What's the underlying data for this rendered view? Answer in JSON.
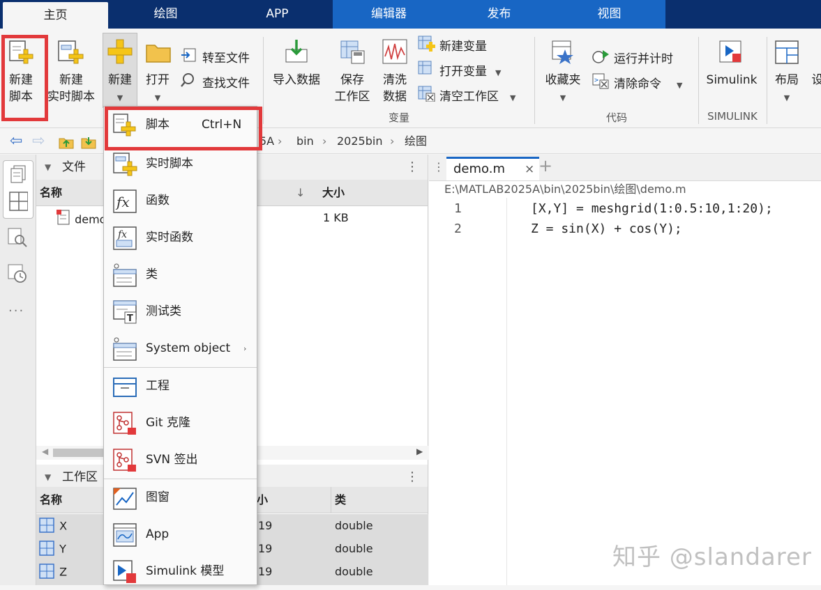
{
  "tabs": [
    "主页",
    "绘图",
    "APP",
    "编辑器",
    "发布",
    "视图"
  ],
  "ribbon": {
    "new_script": "新建\n脚本",
    "new_live_script": "新建\n实时脚本",
    "new": "新建",
    "open": "打开",
    "goto_file": "转至文件",
    "find_files": "查找文件",
    "import_data": "导入数据",
    "save_workspace": "保存\n工作区",
    "clean_data": "清洗\n数据",
    "new_variable": "新建变量",
    "open_variable": "打开变量",
    "clear_workspace": "清空工作区",
    "group_variable": "变量",
    "favorites": "收藏夹",
    "run_and_time": "运行并计时",
    "clear_commands": "清除命令",
    "group_code": "代码",
    "simulink": "Simulink",
    "group_simulink": "SIMULINK",
    "layout": "布局",
    "settings_cut": "设"
  },
  "address": {
    "crumbs": [
      "5A",
      "bin",
      "2025bin",
      "绘图"
    ]
  },
  "files_panel": {
    "title": "文件",
    "col_name": "名称",
    "col_size": "大小",
    "file_name": "demo",
    "file_size": "1 KB"
  },
  "workspace_panel": {
    "title": "工作区",
    "col_name": "名称",
    "col_value": "小",
    "col_class": "类",
    "rows": [
      {
        "name": "X",
        "size": "19",
        "class": "double"
      },
      {
        "name": "Y",
        "size": "19",
        "class": "double"
      },
      {
        "name": "Z",
        "size": "19",
        "class": "double"
      }
    ]
  },
  "editor": {
    "tab_name": "demo.m",
    "path": "E:\\MATLAB2025A\\bin\\2025bin\\绘图\\demo.m",
    "lines": [
      {
        "num": "1",
        "code": "[X,Y] = meshgrid(1:0.5:10,1:20);"
      },
      {
        "num": "2",
        "code": "Z = sin(X) + cos(Y);"
      }
    ]
  },
  "new_menu": {
    "items": [
      {
        "label": "脚本",
        "shortcut": "Ctrl+N"
      },
      {
        "label": "实时脚本"
      },
      {
        "label": "函数"
      },
      {
        "label": "实时函数"
      },
      {
        "label": "类"
      },
      {
        "label": "测试类"
      },
      {
        "label": "System object"
      },
      {
        "label": "工程"
      },
      {
        "label": "Git 克隆"
      },
      {
        "label": "SVN 签出"
      },
      {
        "label": "图窗"
      },
      {
        "label": "App"
      },
      {
        "label": "Simulink 模型"
      }
    ]
  },
  "watermark": "知乎 @slandarer",
  "colors": {
    "tab_dark": "#0a2f6e",
    "tab_blue": "#1866c4",
    "highlight_red": "#e2393b",
    "icon_yellow": "#f5c518"
  }
}
